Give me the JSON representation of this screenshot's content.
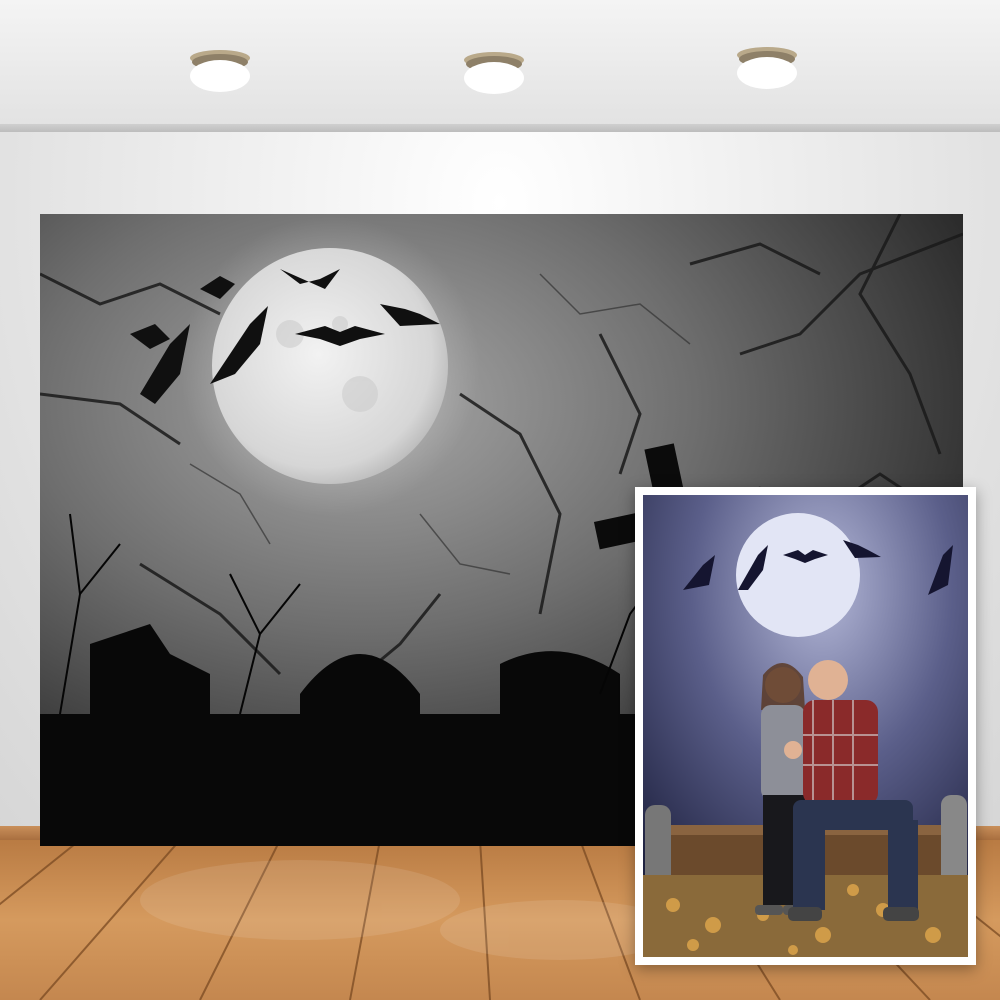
{
  "scene": {
    "ceiling_lights": [
      "ceiling-light",
      "ceiling-light",
      "ceiling-light"
    ],
    "backdrop": "halloween-graveyard-backdrop",
    "inset": "sample-photo-couple"
  },
  "colors": {
    "wall": "#e8e8e8",
    "floor_wood": "#c98a4c",
    "backdrop_sky": "#8f8f8f",
    "moon": "#e9e9e9",
    "silhouette": "#0b0b0b",
    "inset_sky": "#5b5f8a"
  }
}
